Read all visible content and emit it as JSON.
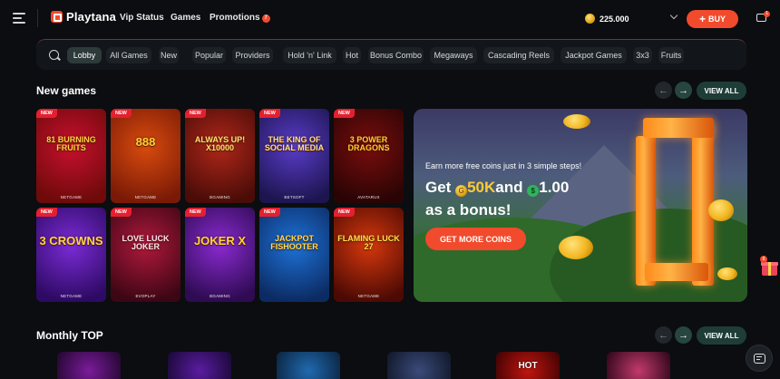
{
  "header": {
    "brand": "Playtana",
    "nav": [
      {
        "label": "Vip Status"
      },
      {
        "label": "Games"
      },
      {
        "label": "Promotions",
        "badge": "7"
      }
    ],
    "balance": "225.000",
    "buy_label": "BUY",
    "messages_badge": "1"
  },
  "categories": [
    "Lobby",
    "All Games",
    "New",
    "Popular",
    "Providers",
    "Hold 'n' Link",
    "Hot",
    "Bonus Combo",
    "Megaways",
    "Cascading Reels",
    "Jackpot Games",
    "3x3",
    "Fruits"
  ],
  "active_category": "Lobby",
  "new_games": {
    "title": "New games",
    "view_all": "VIEW ALL",
    "badge": "NEW",
    "games": [
      {
        "title": "81 BURNING FRUITS",
        "provider": "NETGAME",
        "colors": [
          "#c8102e",
          "#6e0a0a"
        ],
        "accent": "#ffd23a"
      },
      {
        "title": "888",
        "provider": "NETGAME",
        "colors": [
          "#d94b0e",
          "#7a1a06"
        ],
        "accent": "#ffcf33"
      },
      {
        "title": "ALWAYS UP! X10000",
        "provider": "BGAMING",
        "colors": [
          "#b0271a",
          "#4a0c07"
        ],
        "accent": "#ffe36b"
      },
      {
        "title": "THE KING OF SOCIAL MEDIA",
        "provider": "BETSOFT",
        "colors": [
          "#5a3cc9",
          "#1d1550"
        ],
        "accent": "#ffe28a"
      },
      {
        "title": "3 POWER DRAGONS",
        "provider": "AVATARUX",
        "colors": [
          "#7a0d0d",
          "#2a0404"
        ],
        "accent": "#ffcc33"
      },
      {
        "title": "3 CROWNS",
        "provider": "NETGAME",
        "colors": [
          "#7b2bd6",
          "#2d0a63"
        ],
        "accent": "#ffd34a"
      },
      {
        "title": "LOVE LUCK JOKER",
        "provider": "EVOPLAY",
        "colors": [
          "#b0193d",
          "#3d0614"
        ],
        "accent": "#ffe5f0"
      },
      {
        "title": "JOKER X",
        "provider": "BGAMING",
        "colors": [
          "#8a2ad0",
          "#2e0b52"
        ],
        "accent": "#ffd23a"
      },
      {
        "title": "JACKPOT FISHOOTER",
        "provider": "",
        "colors": [
          "#1d72d8",
          "#0c2b63"
        ],
        "accent": "#ffdd55"
      },
      {
        "title": "FLAMING LUCK 27",
        "provider": "NETGAME",
        "colors": [
          "#d6380c",
          "#4d0a04"
        ],
        "accent": "#ffe14a"
      }
    ]
  },
  "banner": {
    "subtitle": "Earn more free coins just in 3 simple steps!",
    "line1_prefix": "Get",
    "gc_amount": "50K",
    "and": "and",
    "sc_amount": "1.00",
    "line2": "as a bonus!",
    "cta": "GET MORE COINS"
  },
  "monthly_top": {
    "title": "Monthly TOP",
    "view_all": "VIEW ALL",
    "tiles": [
      {
        "colors": [
          "#7a1b9a",
          "#2a0838"
        ],
        "label": ""
      },
      {
        "colors": [
          "#5a1ca0",
          "#1f0a40"
        ],
        "label": ""
      },
      {
        "colors": [
          "#1f6ab0",
          "#0d2a4a"
        ],
        "label": ""
      },
      {
        "colors": [
          "#3a4a7a",
          "#141c30"
        ],
        "label": ""
      },
      {
        "colors": [
          "#c2150f",
          "#4a0404"
        ],
        "label": "HOT"
      },
      {
        "colors": [
          "#c13a6a",
          "#3a0a20"
        ],
        "label": ""
      }
    ]
  },
  "gift_badge": "8"
}
